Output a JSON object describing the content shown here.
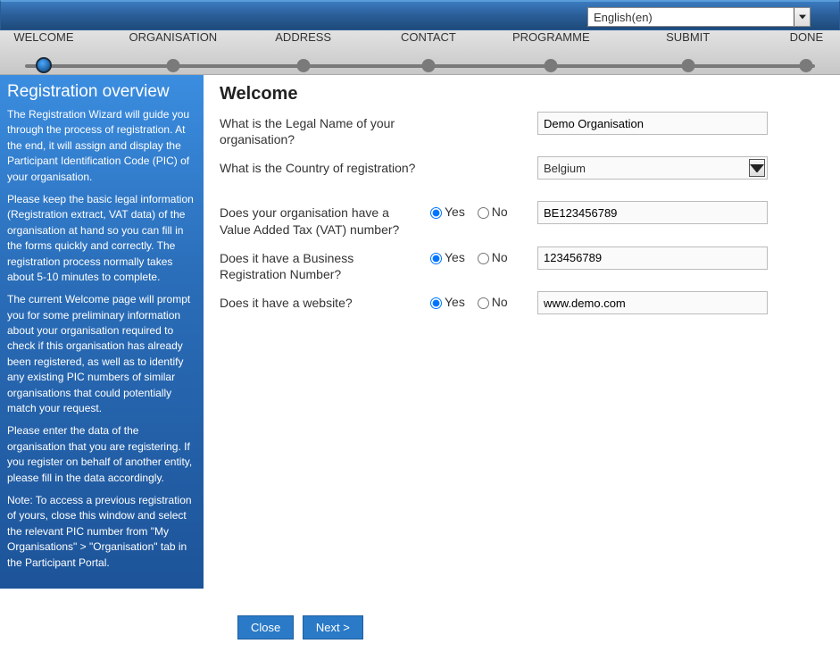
{
  "language": {
    "selected": "English(en)"
  },
  "steps": [
    {
      "label": "WELCOME",
      "pos": 5.2,
      "active": true
    },
    {
      "label": "ORGANISATION",
      "pos": 20.6,
      "active": false
    },
    {
      "label": "ADDRESS",
      "pos": 36.1,
      "active": false
    },
    {
      "label": "CONTACT",
      "pos": 51.0,
      "active": false
    },
    {
      "label": "PROGRAMME",
      "pos": 65.6,
      "active": false
    },
    {
      "label": "SUBMIT",
      "pos": 81.9,
      "active": false
    },
    {
      "label": "DONE",
      "pos": 96.0,
      "active": false
    }
  ],
  "sidebar": {
    "heading": "Registration overview",
    "p1": "The Registration Wizard will guide you through the process of registration. At the end, it will assign and display the Participant Identification Code (PIC) of your organisation.",
    "p2": "Please keep the basic legal information (Registration extract, VAT data) of the organisation at hand so you can fill in the forms quickly and correctly. The registration process normally takes about 5-10 minutes to complete.",
    "p3": "The current Welcome page will prompt you for some preliminary information about your organisation required to check if this organisation has already been registered, as well as to identify any existing PIC numbers of similar organisations that could potentially match your request.",
    "p4": "Please enter the data of the organisation that you are registering. If you register on behalf of another entity, please fill in the data accordingly.",
    "p5": "Note: To access a previous registration of yours, close this window and select the relevant PIC number from \"My Organisations\" > \"Organisation\" tab in the Participant Portal."
  },
  "form": {
    "heading": "Welcome",
    "q_legal_name": "What is the Legal Name of your organisation?",
    "q_country": "What is the Country of registration?",
    "q_vat": "Does your organisation have a Value Added Tax (VAT) number?",
    "q_brn": "Does it have a Business Registration Number?",
    "q_website": "Does it have a website?",
    "yes": "Yes",
    "no": "No",
    "values": {
      "legal_name": "Demo Organisation",
      "country": "Belgium",
      "vat": "BE123456789",
      "brn": "123456789",
      "website": "www.demo.com"
    }
  },
  "buttons": {
    "close": "Close",
    "next": "Next >"
  }
}
